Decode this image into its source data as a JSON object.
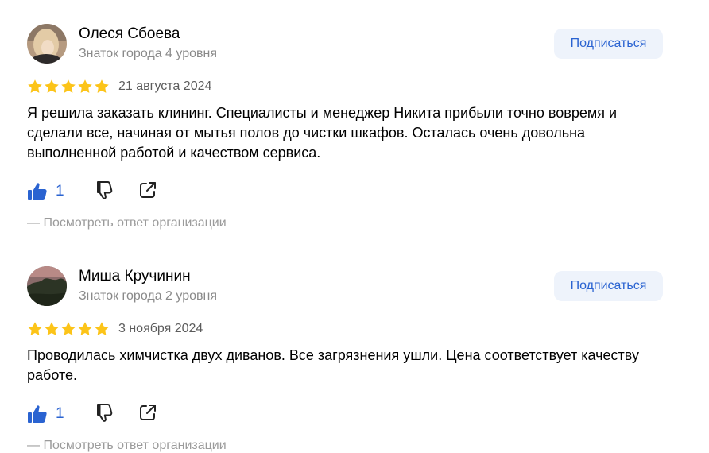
{
  "colors": {
    "star": "#fcc419",
    "accent": "#2a63d1",
    "button_bg": "#eef3fb",
    "muted": "#8a8a8a"
  },
  "reviews": [
    {
      "author": "Олеся Сбоева",
      "level": "Знаток города 4 уровня",
      "subscribe_label": "Подписаться",
      "rating": 5,
      "date": "21 августа 2024",
      "text": "Я решила заказать клининг. Специалисты и менеджер Никита прибыли точно вовремя и сделали все, начиная от мытья полов до чистки шкафов. Осталась очень довольна выполненной работой и качеством сервиса.",
      "likes": "1",
      "like_icon": "thumbs-up-icon",
      "dislike_icon": "thumbs-down-icon",
      "share_icon": "share-icon",
      "org_reply_label": "— Посмотреть ответ организации"
    },
    {
      "author": "Миша Кручинин",
      "level": "Знаток города 2 уровня",
      "subscribe_label": "Подписаться",
      "rating": 5,
      "date": "3 ноября 2024",
      "text": "Проводилась химчистка двух диванов. Все загрязнения ушли. Цена соответствует качеству работе.",
      "likes": "1",
      "like_icon": "thumbs-up-icon",
      "dislike_icon": "thumbs-down-icon",
      "share_icon": "share-icon",
      "org_reply_label": "— Посмотреть ответ организации"
    }
  ]
}
